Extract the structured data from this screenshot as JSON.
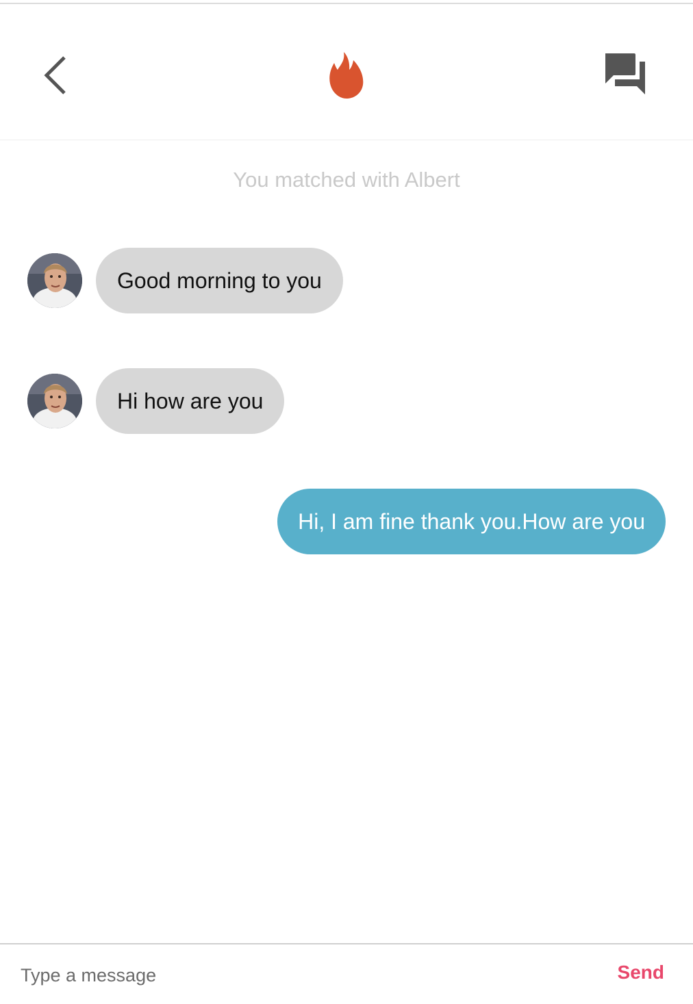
{
  "header": {
    "back_icon": "chevron-left-icon",
    "logo_icon": "flame-icon",
    "chat_icon": "chat-bubbles-icon",
    "logo_color": "#d9542f",
    "icon_color": "#555555"
  },
  "conversation": {
    "match_note": "You matched with Albert",
    "messages": [
      {
        "direction": "in",
        "text": "Good morning to you"
      },
      {
        "direction": "in",
        "text": "Hi how are you"
      },
      {
        "direction": "out",
        "text": "Hi, I am fine thank you.How are you"
      }
    ],
    "incoming_bubble_color": "#d7d7d7",
    "outgoing_bubble_color": "#58b0cb"
  },
  "composer": {
    "placeholder": "Type a message",
    "value": "",
    "send_label": "Send",
    "send_color": "#e8476b"
  }
}
